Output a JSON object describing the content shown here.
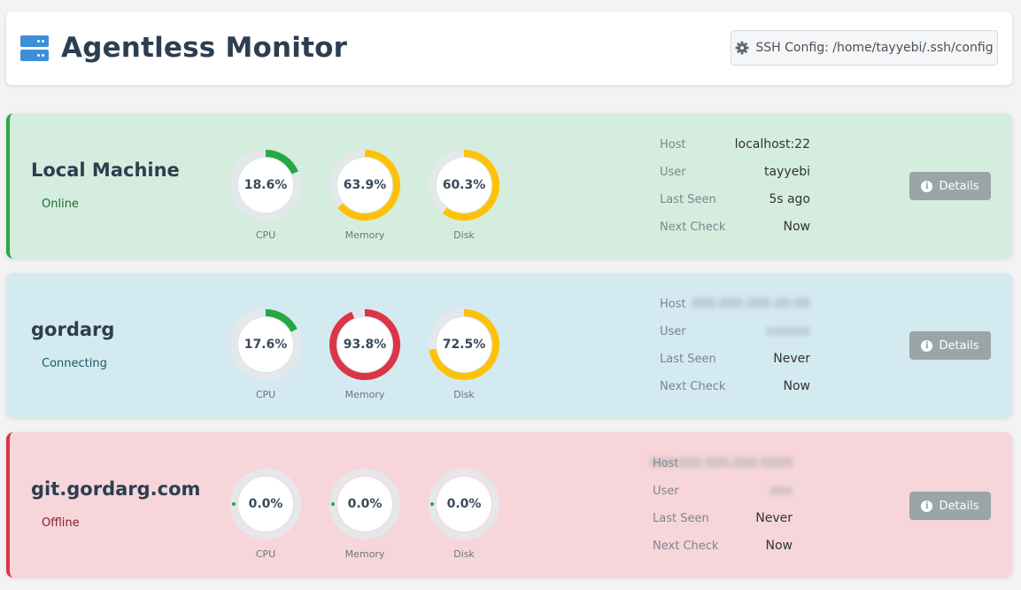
{
  "header": {
    "title": "Agentless Monitor",
    "logo_icon": "server-icon",
    "ssh_config_label": "SSH Config: /home/tayyebi/.ssh/config",
    "ssh_config_icon": "gear-icon"
  },
  "colors": {
    "online": "#28a745",
    "warning": "#ffc107",
    "danger": "#dc3545",
    "track": "#e5e7ea",
    "brand": "#3d8fd9"
  },
  "machines": [
    {
      "name": "Local Machine",
      "status": "Online",
      "metrics": [
        {
          "label": "CPU",
          "value": 18.6,
          "display": "18.6%",
          "color": "#28a745"
        },
        {
          "label": "Memory",
          "value": 63.9,
          "display": "63.9%",
          "color": "#ffc107"
        },
        {
          "label": "Disk",
          "value": 60.3,
          "display": "60.3%",
          "color": "#ffc107"
        }
      ],
      "info": [
        {
          "key": "Host",
          "value": "localhost:22",
          "blurred": false
        },
        {
          "key": "User",
          "value": "tayyebi",
          "blurred": false
        },
        {
          "key": "Last Seen",
          "value": "5s ago",
          "blurred": false
        },
        {
          "key": "Next Check",
          "value": "Now",
          "blurred": false
        }
      ],
      "details_label": "Details"
    },
    {
      "name": "gordarg",
      "status": "Connecting",
      "metrics": [
        {
          "label": "CPU",
          "value": 17.6,
          "display": "17.6%",
          "color": "#28a745"
        },
        {
          "label": "Memory",
          "value": 93.8,
          "display": "93.8%",
          "color": "#dc3545"
        },
        {
          "label": "Disk",
          "value": 72.5,
          "display": "72.5%",
          "color": "#ffc107"
        }
      ],
      "info": [
        {
          "key": "Host",
          "value": "",
          "blurred": true
        },
        {
          "key": "User",
          "value": "",
          "blurred": true
        },
        {
          "key": "Last Seen",
          "value": "Never",
          "blurred": false
        },
        {
          "key": "Next Check",
          "value": "Now",
          "blurred": false
        }
      ],
      "details_label": "Details"
    },
    {
      "name": "git.gordarg.com",
      "status": "Offline",
      "metrics": [
        {
          "label": "CPU",
          "value": 0.0,
          "display": "0.0%",
          "color": "#28a745"
        },
        {
          "label": "Memory",
          "value": 0.0,
          "display": "0.0%",
          "color": "#28a745"
        },
        {
          "label": "Disk",
          "value": 0.0,
          "display": "0.0%",
          "color": "#28a745"
        }
      ],
      "info": [
        {
          "key": "Host",
          "value": "",
          "blurred": true
        },
        {
          "key": "User",
          "value": "",
          "blurred": true
        },
        {
          "key": "Last Seen",
          "value": "Never",
          "blurred": false
        },
        {
          "key": "Next Check",
          "value": "Now",
          "blurred": false
        }
      ],
      "details_label": "Details"
    }
  ]
}
